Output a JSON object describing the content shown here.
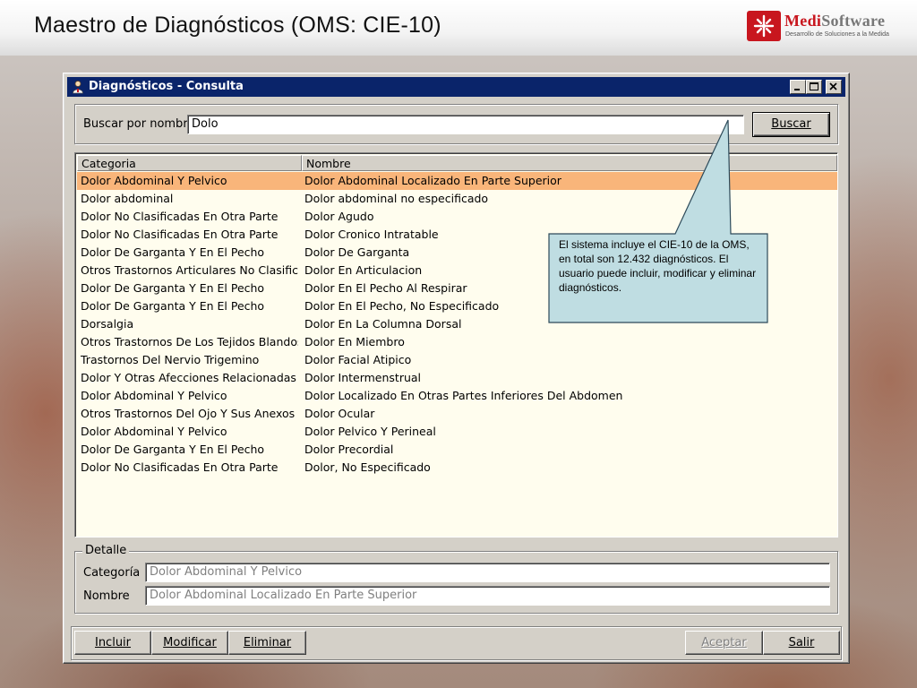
{
  "slide": {
    "title": "Maestro de Diagnósticos (OMS: CIE-10)",
    "logo_name_part1": "Medi",
    "logo_name_part2": "Software",
    "logo_tagline": "Desarrollo de Soluciones a la Medida"
  },
  "window": {
    "title": "Diagnósticos - Consulta",
    "controls": {
      "minimize": "minimize-icon",
      "maximize": "maximize-icon",
      "close": "close-icon"
    }
  },
  "search": {
    "label": "Buscar por nombre",
    "value": "Dolo",
    "button": "Buscar"
  },
  "grid": {
    "columns": [
      "Categoria",
      "Nombre"
    ],
    "selected_row": 0,
    "rows": [
      [
        "Dolor Abdominal Y Pelvico",
        "Dolor Abdominal Localizado En Parte Superior"
      ],
      [
        "Dolor abdominal",
        "Dolor abdominal no especificado"
      ],
      [
        "Dolor No Clasificadas En Otra Parte",
        "Dolor Agudo"
      ],
      [
        "Dolor No Clasificadas En Otra Parte",
        "Dolor Cronico Intratable"
      ],
      [
        "Dolor De Garganta Y En El Pecho",
        "Dolor De Garganta"
      ],
      [
        "Otros Trastornos Articulares No Clasificad",
        "Dolor En Articulacion"
      ],
      [
        "Dolor De Garganta Y En El Pecho",
        "Dolor En El Pecho Al Respirar"
      ],
      [
        "Dolor De Garganta Y En El Pecho",
        "Dolor En El Pecho, No Especificado"
      ],
      [
        "Dorsalgia",
        "Dolor En La Columna Dorsal"
      ],
      [
        "Otros Trastornos De Los Tejidos Blandos",
        "Dolor En Miembro"
      ],
      [
        "Trastornos Del Nervio Trigemino",
        "Dolor Facial Atipico"
      ],
      [
        "Dolor Y Otras Afecciones Relacionadas C",
        "Dolor Intermenstrual"
      ],
      [
        "Dolor Abdominal Y Pelvico",
        "Dolor Localizado En Otras Partes Inferiores Del Abdomen"
      ],
      [
        "Otros Trastornos Del Ojo Y Sus Anexos",
        "Dolor Ocular"
      ],
      [
        "Dolor Abdominal Y Pelvico",
        "Dolor Pelvico Y Perineal"
      ],
      [
        "Dolor De Garganta Y En El Pecho",
        "Dolor Precordial"
      ],
      [
        "Dolor No Clasificadas En Otra Parte",
        "Dolor, No Especificado"
      ]
    ]
  },
  "detail": {
    "group_label": "Detalle",
    "category_label": "Categoría",
    "category_value": "Dolor Abdominal Y Pelvico",
    "name_label": "Nombre",
    "name_value": "Dolor Abdominal Localizado En Parte Superior"
  },
  "buttons": {
    "incluir": "Incluir",
    "modificar": "Modificar",
    "eliminar": "Eliminar",
    "aceptar": "Aceptar",
    "salir": "Salir"
  },
  "callout": {
    "text": "El sistema incluye el CIE-10 de la OMS, en total son 12.432 diagnósticos. El usuario puede incluir, modificar y eliminar diagnósticos."
  }
}
